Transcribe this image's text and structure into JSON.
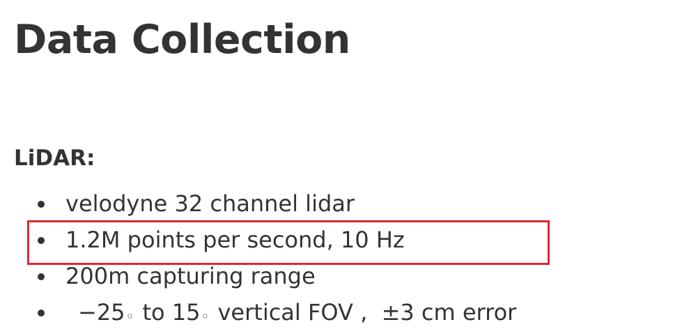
{
  "title": "Data Collection",
  "section": {
    "heading": "LiDAR:"
  },
  "items": [
    {
      "text": "velodyne 32 channel lidar"
    },
    {
      "text": "1.2M points per second, 10 Hz"
    },
    {
      "text": "200m capturing range"
    },
    {
      "parts": {
        "low": "−25",
        "deg1": "◦",
        "to": " to 15",
        "deg2": "◦",
        "fov": " vertical FOV ,  ",
        "err": "±3 cm error"
      }
    }
  ],
  "highlight": {
    "item_index": 1,
    "color": "#e0252e"
  },
  "colors": {
    "text": "#333333",
    "background": "#ffffff"
  }
}
